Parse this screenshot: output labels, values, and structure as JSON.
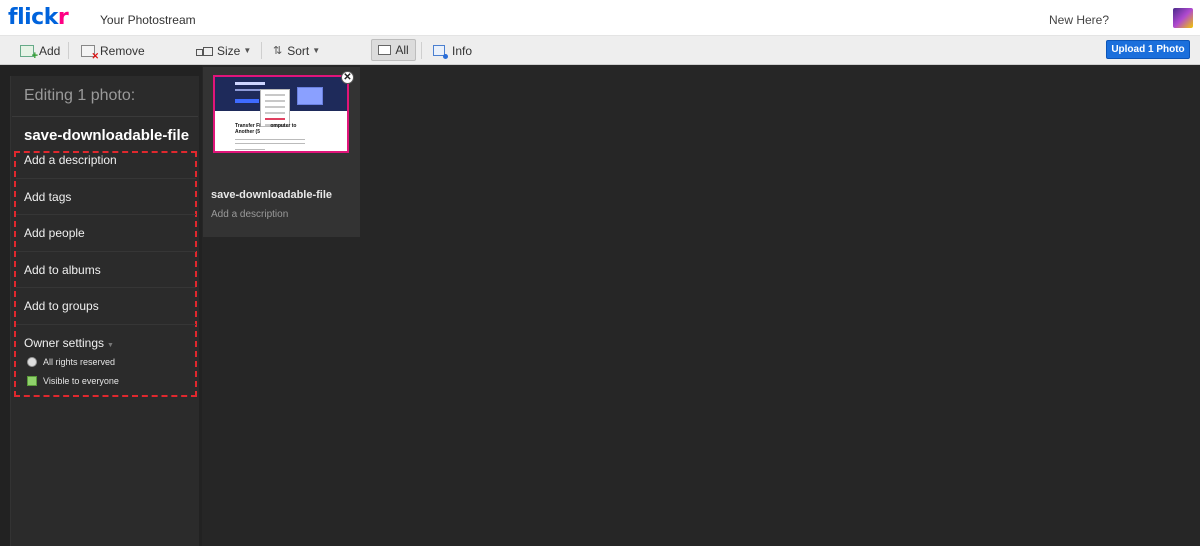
{
  "header": {
    "logo_part1": "flick",
    "logo_part2": "r",
    "page_title": "Your Photostream",
    "new_here": "New Here?"
  },
  "toolbar": {
    "add_label": "Add",
    "remove_label": "Remove",
    "size_label": "Size",
    "sort_label": "Sort",
    "all_label": "All",
    "info_label": "Info",
    "upload_label": "Upload 1 Photo"
  },
  "panel": {
    "editing_label": "Editing 1 photo:",
    "file_name": "save-downloadable-file",
    "options": [
      "Add a description",
      "Add tags",
      "Add people",
      "Add to albums",
      "Add to groups"
    ],
    "owner_settings": "Owner settings",
    "rights": "All rights reserved",
    "visibility": "Visible to everyone"
  },
  "photo": {
    "name": "save-downloadable-file",
    "description_placeholder": "Add a description",
    "thumb_title_line1": "Transfer Fi",
    "thumb_title_line1b": "omputer to",
    "thumb_title_line2": "Another (5"
  },
  "colors": {
    "brand_blue": "#0063dc",
    "brand_pink": "#ff0084",
    "upload_button": "#1b6fdc",
    "highlight_dash": "#e0282e",
    "thumb_border": "#e0157a"
  }
}
